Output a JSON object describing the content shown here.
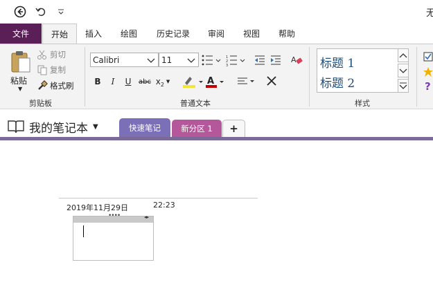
{
  "window": {
    "title_fragment": "无"
  },
  "qat": {
    "back": "back-icon",
    "undo": "undo-icon",
    "customize": "customize-qat-icon"
  },
  "tabs": [
    {
      "id": "file",
      "label": "文件"
    },
    {
      "id": "home",
      "label": "开始",
      "active": true
    },
    {
      "id": "insert",
      "label": "插入"
    },
    {
      "id": "draw",
      "label": "绘图"
    },
    {
      "id": "history",
      "label": "历史记录"
    },
    {
      "id": "review",
      "label": "审阅"
    },
    {
      "id": "view",
      "label": "视图"
    },
    {
      "id": "help",
      "label": "帮助"
    }
  ],
  "clipboard": {
    "paste": "粘贴",
    "cut": "剪切",
    "copy": "复制",
    "format_painter": "格式刷",
    "group": "剪贴板"
  },
  "basic_text": {
    "font": "Calibri",
    "size": "11",
    "bold": "B",
    "italic": "I",
    "underline": "U",
    "strike": "abc",
    "subscript": "x",
    "sub_mark": "2",
    "group": "普通文本",
    "highlight_color": "#f5e43a",
    "font_color": "#c00000"
  },
  "styles": {
    "items": [
      {
        "label": "标题 1"
      },
      {
        "label": "标题 2"
      }
    ],
    "group": "样式"
  },
  "notebook": {
    "name": "我的笔记本",
    "sections": [
      {
        "label": "快速笔记",
        "color": "#7b70b7",
        "active": true
      },
      {
        "label": "新分区 1",
        "color": "#b4579b"
      }
    ],
    "add": "+"
  },
  "page": {
    "date": "2019年11月29日",
    "time": "22:23"
  }
}
